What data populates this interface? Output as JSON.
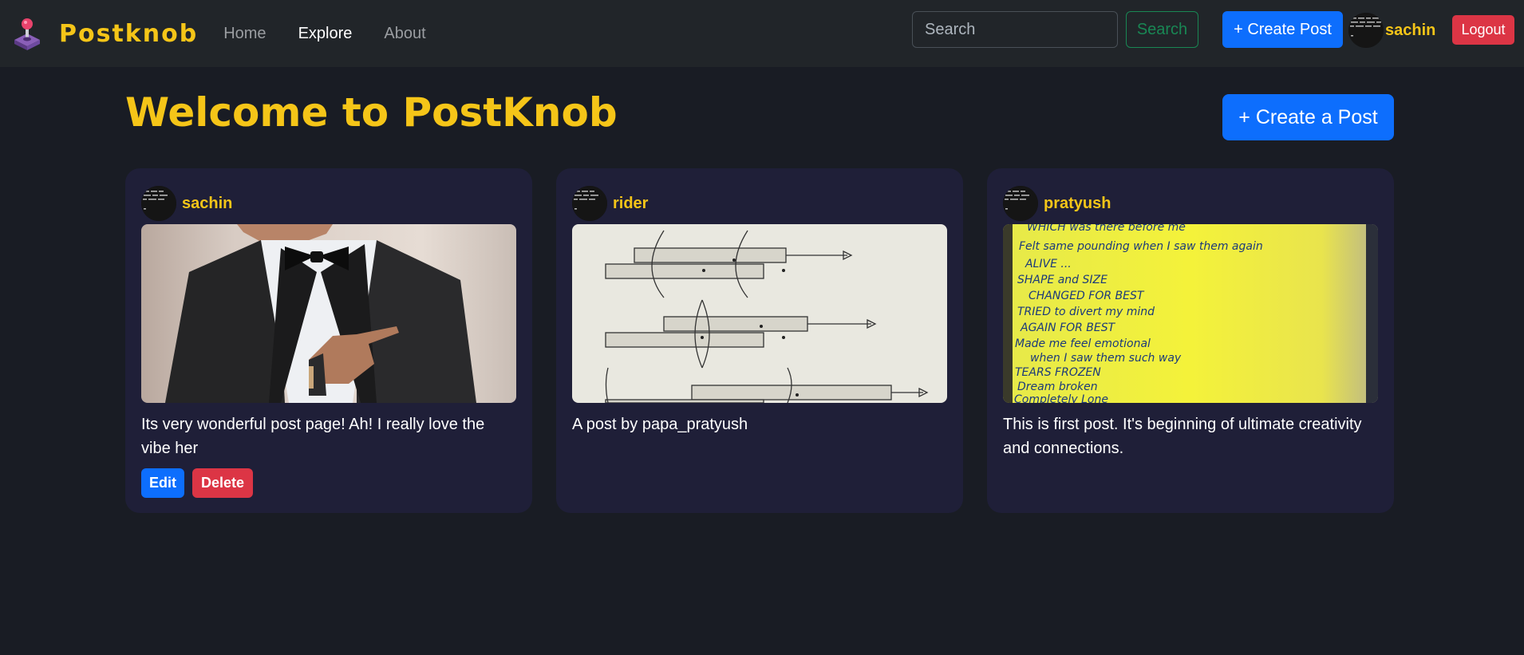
{
  "navbar": {
    "brand": "Postknob",
    "links": [
      {
        "label": "Home"
      },
      {
        "label": "Explore"
      },
      {
        "label": "About"
      }
    ],
    "search_placeholder": "Search",
    "search_button": "Search",
    "create_post": "+ Create Post",
    "username": "sachin",
    "logout": "Logout"
  },
  "main": {
    "title": "Welcome to PostKnob",
    "create_post": "+ Create a Post"
  },
  "posts": [
    {
      "username": "sachin",
      "text": "Its very wonderful post page! Ah! I really love the vibe her",
      "edit": "Edit",
      "delete": "Delete"
    },
    {
      "username": "rider",
      "text": "A post by papa_pratyush"
    },
    {
      "username": "pratyush",
      "text": "This is first post. It's beginning of ultimate creativity and connections.",
      "handwriting": [
        "WHICH was there before me",
        "Felt same pounding when I saw them again",
        "ALIVE ...",
        "SHAPE and SIZE",
        "CHANGED FOR BEST",
        "TRIED to divert my mind",
        "AGAIN FOR BEST",
        "Made me feel emotional",
        "when I saw them such way",
        "TEARS FROZEN",
        "Dream broken",
        "Completely Lone"
      ]
    }
  ],
  "colors": {
    "accent": "#f5c518",
    "primary": "#0d6efd",
    "danger": "#dc3545",
    "success": "#198754",
    "navbar_bg": "#212529",
    "page_bg": "#191c24",
    "card_bg": "#1f1f38"
  },
  "icons": {
    "brand": "joystick-icon"
  }
}
